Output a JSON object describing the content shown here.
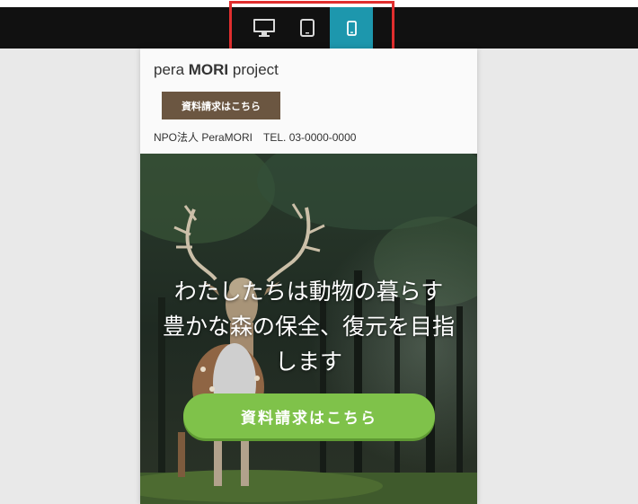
{
  "toolbar": {
    "devices": [
      {
        "name": "desktop",
        "icon": "desktop-icon",
        "active": false
      },
      {
        "name": "tablet",
        "icon": "tablet-icon",
        "active": false
      },
      {
        "name": "mobile",
        "icon": "mobile-icon",
        "active": true
      }
    ],
    "active_color": "#1d97ad",
    "highlight_color": "#e02e2e"
  },
  "site": {
    "title_prefix": "pera ",
    "title_bold": "MORI",
    "title_suffix": " project",
    "header_cta": "資料請求はこちら",
    "header_cta_color": "#6b5641",
    "org": "NPO法人 PeraMORI",
    "tel": "TEL. 03-0000-0000"
  },
  "hero": {
    "line1": "わたしたちは動物の暮らす",
    "line2": "豊かな森の保全、復元を目指",
    "line3": "します",
    "cta": "資料請求はこちら",
    "cta_color": "#7fc24a"
  }
}
